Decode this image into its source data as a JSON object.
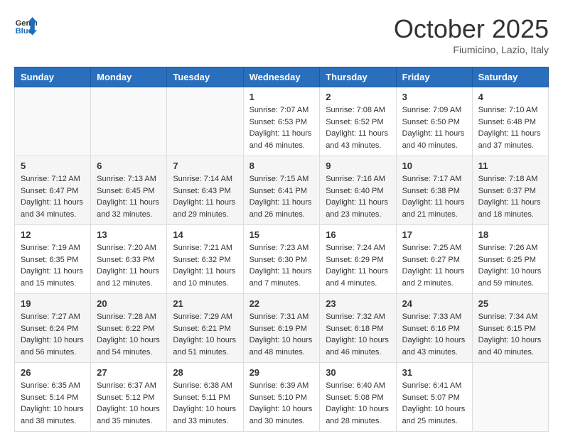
{
  "header": {
    "logo_general": "General",
    "logo_blue": "Blue",
    "month_title": "October 2025",
    "location": "Fiumicino, Lazio, Italy"
  },
  "days_of_week": [
    "Sunday",
    "Monday",
    "Tuesday",
    "Wednesday",
    "Thursday",
    "Friday",
    "Saturday"
  ],
  "weeks": [
    [
      {
        "day": "",
        "info": ""
      },
      {
        "day": "",
        "info": ""
      },
      {
        "day": "",
        "info": ""
      },
      {
        "day": "1",
        "info": "Sunrise: 7:07 AM\nSunset: 6:53 PM\nDaylight: 11 hours and 46 minutes."
      },
      {
        "day": "2",
        "info": "Sunrise: 7:08 AM\nSunset: 6:52 PM\nDaylight: 11 hours and 43 minutes."
      },
      {
        "day": "3",
        "info": "Sunrise: 7:09 AM\nSunset: 6:50 PM\nDaylight: 11 hours and 40 minutes."
      },
      {
        "day": "4",
        "info": "Sunrise: 7:10 AM\nSunset: 6:48 PM\nDaylight: 11 hours and 37 minutes."
      }
    ],
    [
      {
        "day": "5",
        "info": "Sunrise: 7:12 AM\nSunset: 6:47 PM\nDaylight: 11 hours and 34 minutes."
      },
      {
        "day": "6",
        "info": "Sunrise: 7:13 AM\nSunset: 6:45 PM\nDaylight: 11 hours and 32 minutes."
      },
      {
        "day": "7",
        "info": "Sunrise: 7:14 AM\nSunset: 6:43 PM\nDaylight: 11 hours and 29 minutes."
      },
      {
        "day": "8",
        "info": "Sunrise: 7:15 AM\nSunset: 6:41 PM\nDaylight: 11 hours and 26 minutes."
      },
      {
        "day": "9",
        "info": "Sunrise: 7:16 AM\nSunset: 6:40 PM\nDaylight: 11 hours and 23 minutes."
      },
      {
        "day": "10",
        "info": "Sunrise: 7:17 AM\nSunset: 6:38 PM\nDaylight: 11 hours and 21 minutes."
      },
      {
        "day": "11",
        "info": "Sunrise: 7:18 AM\nSunset: 6:37 PM\nDaylight: 11 hours and 18 minutes."
      }
    ],
    [
      {
        "day": "12",
        "info": "Sunrise: 7:19 AM\nSunset: 6:35 PM\nDaylight: 11 hours and 15 minutes."
      },
      {
        "day": "13",
        "info": "Sunrise: 7:20 AM\nSunset: 6:33 PM\nDaylight: 11 hours and 12 minutes."
      },
      {
        "day": "14",
        "info": "Sunrise: 7:21 AM\nSunset: 6:32 PM\nDaylight: 11 hours and 10 minutes."
      },
      {
        "day": "15",
        "info": "Sunrise: 7:23 AM\nSunset: 6:30 PM\nDaylight: 11 hours and 7 minutes."
      },
      {
        "day": "16",
        "info": "Sunrise: 7:24 AM\nSunset: 6:29 PM\nDaylight: 11 hours and 4 minutes."
      },
      {
        "day": "17",
        "info": "Sunrise: 7:25 AM\nSunset: 6:27 PM\nDaylight: 11 hours and 2 minutes."
      },
      {
        "day": "18",
        "info": "Sunrise: 7:26 AM\nSunset: 6:25 PM\nDaylight: 10 hours and 59 minutes."
      }
    ],
    [
      {
        "day": "19",
        "info": "Sunrise: 7:27 AM\nSunset: 6:24 PM\nDaylight: 10 hours and 56 minutes."
      },
      {
        "day": "20",
        "info": "Sunrise: 7:28 AM\nSunset: 6:22 PM\nDaylight: 10 hours and 54 minutes."
      },
      {
        "day": "21",
        "info": "Sunrise: 7:29 AM\nSunset: 6:21 PM\nDaylight: 10 hours and 51 minutes."
      },
      {
        "day": "22",
        "info": "Sunrise: 7:31 AM\nSunset: 6:19 PM\nDaylight: 10 hours and 48 minutes."
      },
      {
        "day": "23",
        "info": "Sunrise: 7:32 AM\nSunset: 6:18 PM\nDaylight: 10 hours and 46 minutes."
      },
      {
        "day": "24",
        "info": "Sunrise: 7:33 AM\nSunset: 6:16 PM\nDaylight: 10 hours and 43 minutes."
      },
      {
        "day": "25",
        "info": "Sunrise: 7:34 AM\nSunset: 6:15 PM\nDaylight: 10 hours and 40 minutes."
      }
    ],
    [
      {
        "day": "26",
        "info": "Sunrise: 6:35 AM\nSunset: 5:14 PM\nDaylight: 10 hours and 38 minutes."
      },
      {
        "day": "27",
        "info": "Sunrise: 6:37 AM\nSunset: 5:12 PM\nDaylight: 10 hours and 35 minutes."
      },
      {
        "day": "28",
        "info": "Sunrise: 6:38 AM\nSunset: 5:11 PM\nDaylight: 10 hours and 33 minutes."
      },
      {
        "day": "29",
        "info": "Sunrise: 6:39 AM\nSunset: 5:10 PM\nDaylight: 10 hours and 30 minutes."
      },
      {
        "day": "30",
        "info": "Sunrise: 6:40 AM\nSunset: 5:08 PM\nDaylight: 10 hours and 28 minutes."
      },
      {
        "day": "31",
        "info": "Sunrise: 6:41 AM\nSunset: 5:07 PM\nDaylight: 10 hours and 25 minutes."
      },
      {
        "day": "",
        "info": ""
      }
    ]
  ]
}
